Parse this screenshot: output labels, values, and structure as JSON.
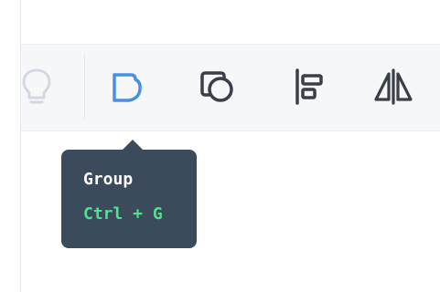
{
  "toolbar": {
    "tools": [
      {
        "name": "lightbulb-icon",
        "state": "faded"
      },
      {
        "name": "group-icon",
        "state": "active",
        "color": "#4a90e2"
      },
      {
        "name": "bring-front-icon",
        "state": "normal"
      },
      {
        "name": "align-left-icon",
        "state": "normal"
      },
      {
        "name": "flip-horizontal-icon",
        "state": "normal"
      }
    ]
  },
  "tooltip": {
    "title": "Group",
    "shortcut": "Ctrl + G",
    "shortcut_color": "#4ee38f",
    "background": "#3b4b5c"
  }
}
